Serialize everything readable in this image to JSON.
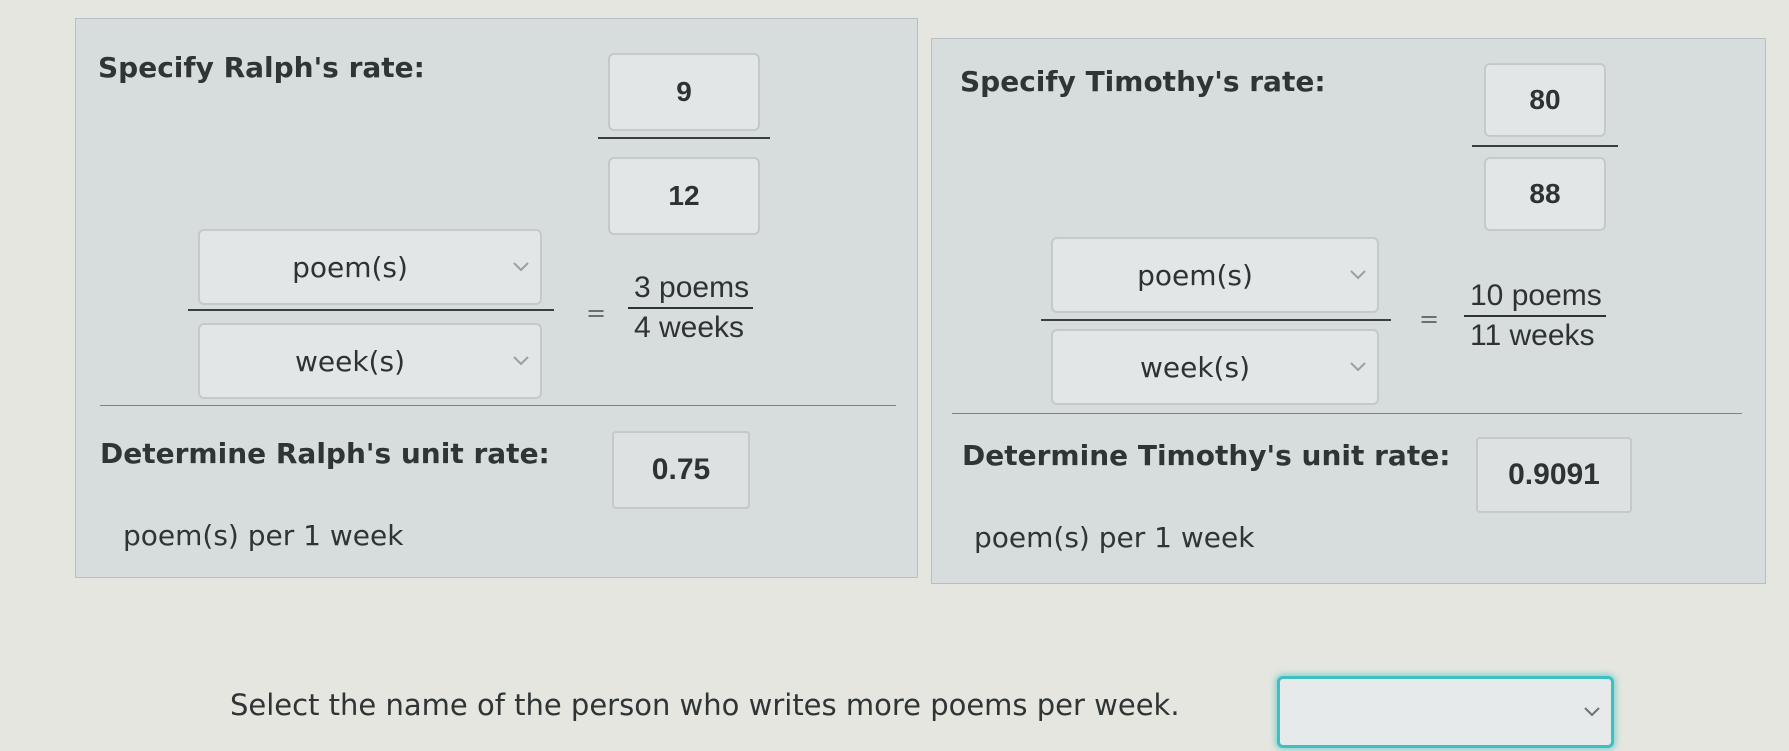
{
  "ralph": {
    "heading": "Specify Ralph's rate:",
    "numerator_value": "9",
    "denominator_value": "12",
    "unit_numerator": "poem(s)",
    "unit_denominator": "week(s)",
    "equals": "=",
    "given_numerator": "3 poems",
    "given_denominator": "4 weeks",
    "unit_rate_label": "Determine Ralph's unit rate:",
    "unit_rate_value": "0.75",
    "unit_rate_suffix": "poem(s) per 1 week"
  },
  "timothy": {
    "heading": "Specify Timothy's rate:",
    "numerator_value": "80",
    "denominator_value": "88",
    "unit_numerator": "poem(s)",
    "unit_denominator": "week(s)",
    "equals": "=",
    "given_numerator": "10 poems",
    "given_denominator": "11 weeks",
    "unit_rate_label": "Determine Timothy's unit rate:",
    "unit_rate_value": "0.9091",
    "unit_rate_suffix": "poem(s) per 1 week"
  },
  "question": {
    "text": "Select the name of the person who writes more poems per week.",
    "selected_value": ""
  },
  "colors": {
    "panel_bg": "#d7dcdd",
    "input_bg": "#e2e6e7",
    "focus_accent": "#3fbfc2"
  },
  "icons": {
    "dropdown": "chevron-down-icon"
  }
}
